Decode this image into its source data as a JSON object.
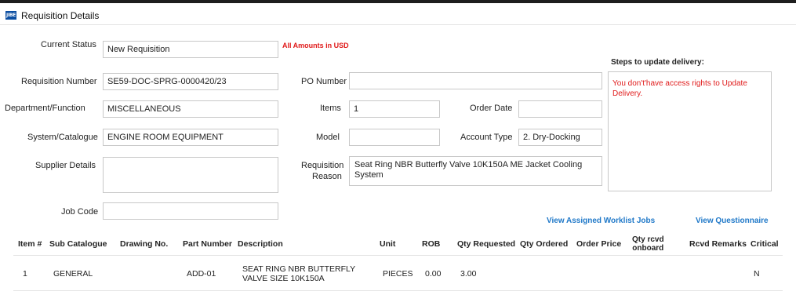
{
  "window": {
    "icon_text": "JIBE",
    "title": "Requisition Details"
  },
  "form": {
    "current_status_label": "Current Status",
    "current_status_value": "New Requisition",
    "amounts_note": "All Amounts in USD",
    "requisition_number_label": "Requisition Number",
    "requisition_number_value": "SE59-DOC-SPRG-0000420/23",
    "department_label": "Department/Function",
    "department_value": "MISCELLANEOUS",
    "system_label": "System/Catalogue",
    "system_value": "ENGINE ROOM EQUIPMENT",
    "supplier_label": "Supplier Details",
    "supplier_value": "",
    "job_code_label": "Job Code",
    "job_code_value": "",
    "po_number_label": "PO Number",
    "po_number_value": "",
    "items_label": "Items",
    "items_value": "1",
    "order_date_label": "Order Date",
    "order_date_value": "",
    "model_label": "Model",
    "model_value": "",
    "account_type_label": "Account Type",
    "account_type_value": "2. Dry-Docking",
    "reason_label_line1": "Requisition",
    "reason_label_line2": "Reason",
    "reason_value": "Seat Ring NBR Butterfly Valve 10K150A ME Jacket Cooling System"
  },
  "steps": {
    "title": "Steps to update delivery:",
    "message": "You don't'have access rights to Update Delivery."
  },
  "links": {
    "view_worklist": "View Assigned Worklist Jobs",
    "view_questionnaire": "View Questionnaire"
  },
  "grid": {
    "headers": {
      "item": "Item #",
      "sub_catalogue": "Sub Catalogue",
      "drawing_no": "Drawing No.",
      "part_number": "Part Number",
      "description": "Description",
      "unit": "Unit",
      "rob": "ROB",
      "qty_requested": "Qty Requested",
      "qty_ordered": "Qty Ordered",
      "order_price": "Order Price",
      "qty_rcvd_onboard_line1": "Qty rcvd",
      "qty_rcvd_onboard_line2": "onboard",
      "rcvd_remarks": "Rcvd Remarks",
      "critical": "Critical"
    },
    "rows": [
      {
        "item": "1",
        "sub_catalogue": "GENERAL",
        "drawing_no": "",
        "part_number": "ADD-01",
        "description": "SEAT RING NBR BUTTERFLY VALVE SIZE 10K150A",
        "unit": "PIECES",
        "rob": "0.00",
        "qty_requested": "3.00",
        "qty_ordered": "",
        "order_price": "",
        "qty_rcvd_onboard": "",
        "rcvd_remarks": "",
        "critical": "N"
      }
    ]
  },
  "colors": {
    "accent_link": "#1f78c8",
    "warning_red": "#e01b1b",
    "app_icon_blue": "#0b4ea2"
  }
}
